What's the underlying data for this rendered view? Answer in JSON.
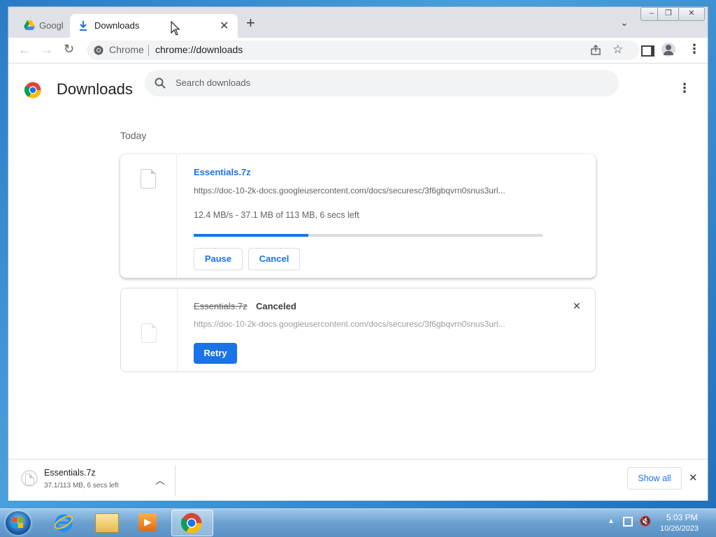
{
  "tabs": [
    {
      "label": "Googl",
      "icon": "google-drive-icon"
    },
    {
      "label": "Downloads",
      "icon": "download-icon"
    }
  ],
  "omnibox": {
    "site_label": "Chrome",
    "url": "chrome://downloads"
  },
  "page": {
    "title": "Downloads",
    "search_placeholder": "Search downloads",
    "section": "Today"
  },
  "downloads": [
    {
      "filename": "Essentials.7z",
      "url": "https://doc-10-2k-docs.googleusercontent.com/docs/securesc/3f6gbqvrn0snus3url...",
      "status": "12.4 MB/s - 37.1 MB of 113 MB, 6 secs left",
      "progress": 0.328,
      "pause_label": "Pause",
      "cancel_label": "Cancel"
    },
    {
      "filename": "Essentials.7z",
      "state": "Canceled",
      "url": "https://doc-10-2k-docs.googleusercontent.com/docs/securesc/3f6gbqvrn0snus3url...",
      "retry_label": "Retry"
    }
  ],
  "shelf": {
    "filename": "Essentials.7z",
    "status": "37.1/113 MB, 6 secs left",
    "show_all_label": "Show all"
  },
  "taskbar": {
    "time": "5:03 PM",
    "date": "10/26/2023"
  },
  "colors": {
    "accent": "#1a73e8",
    "link": "#1a73e8",
    "tabbar": "#dee1e6"
  }
}
